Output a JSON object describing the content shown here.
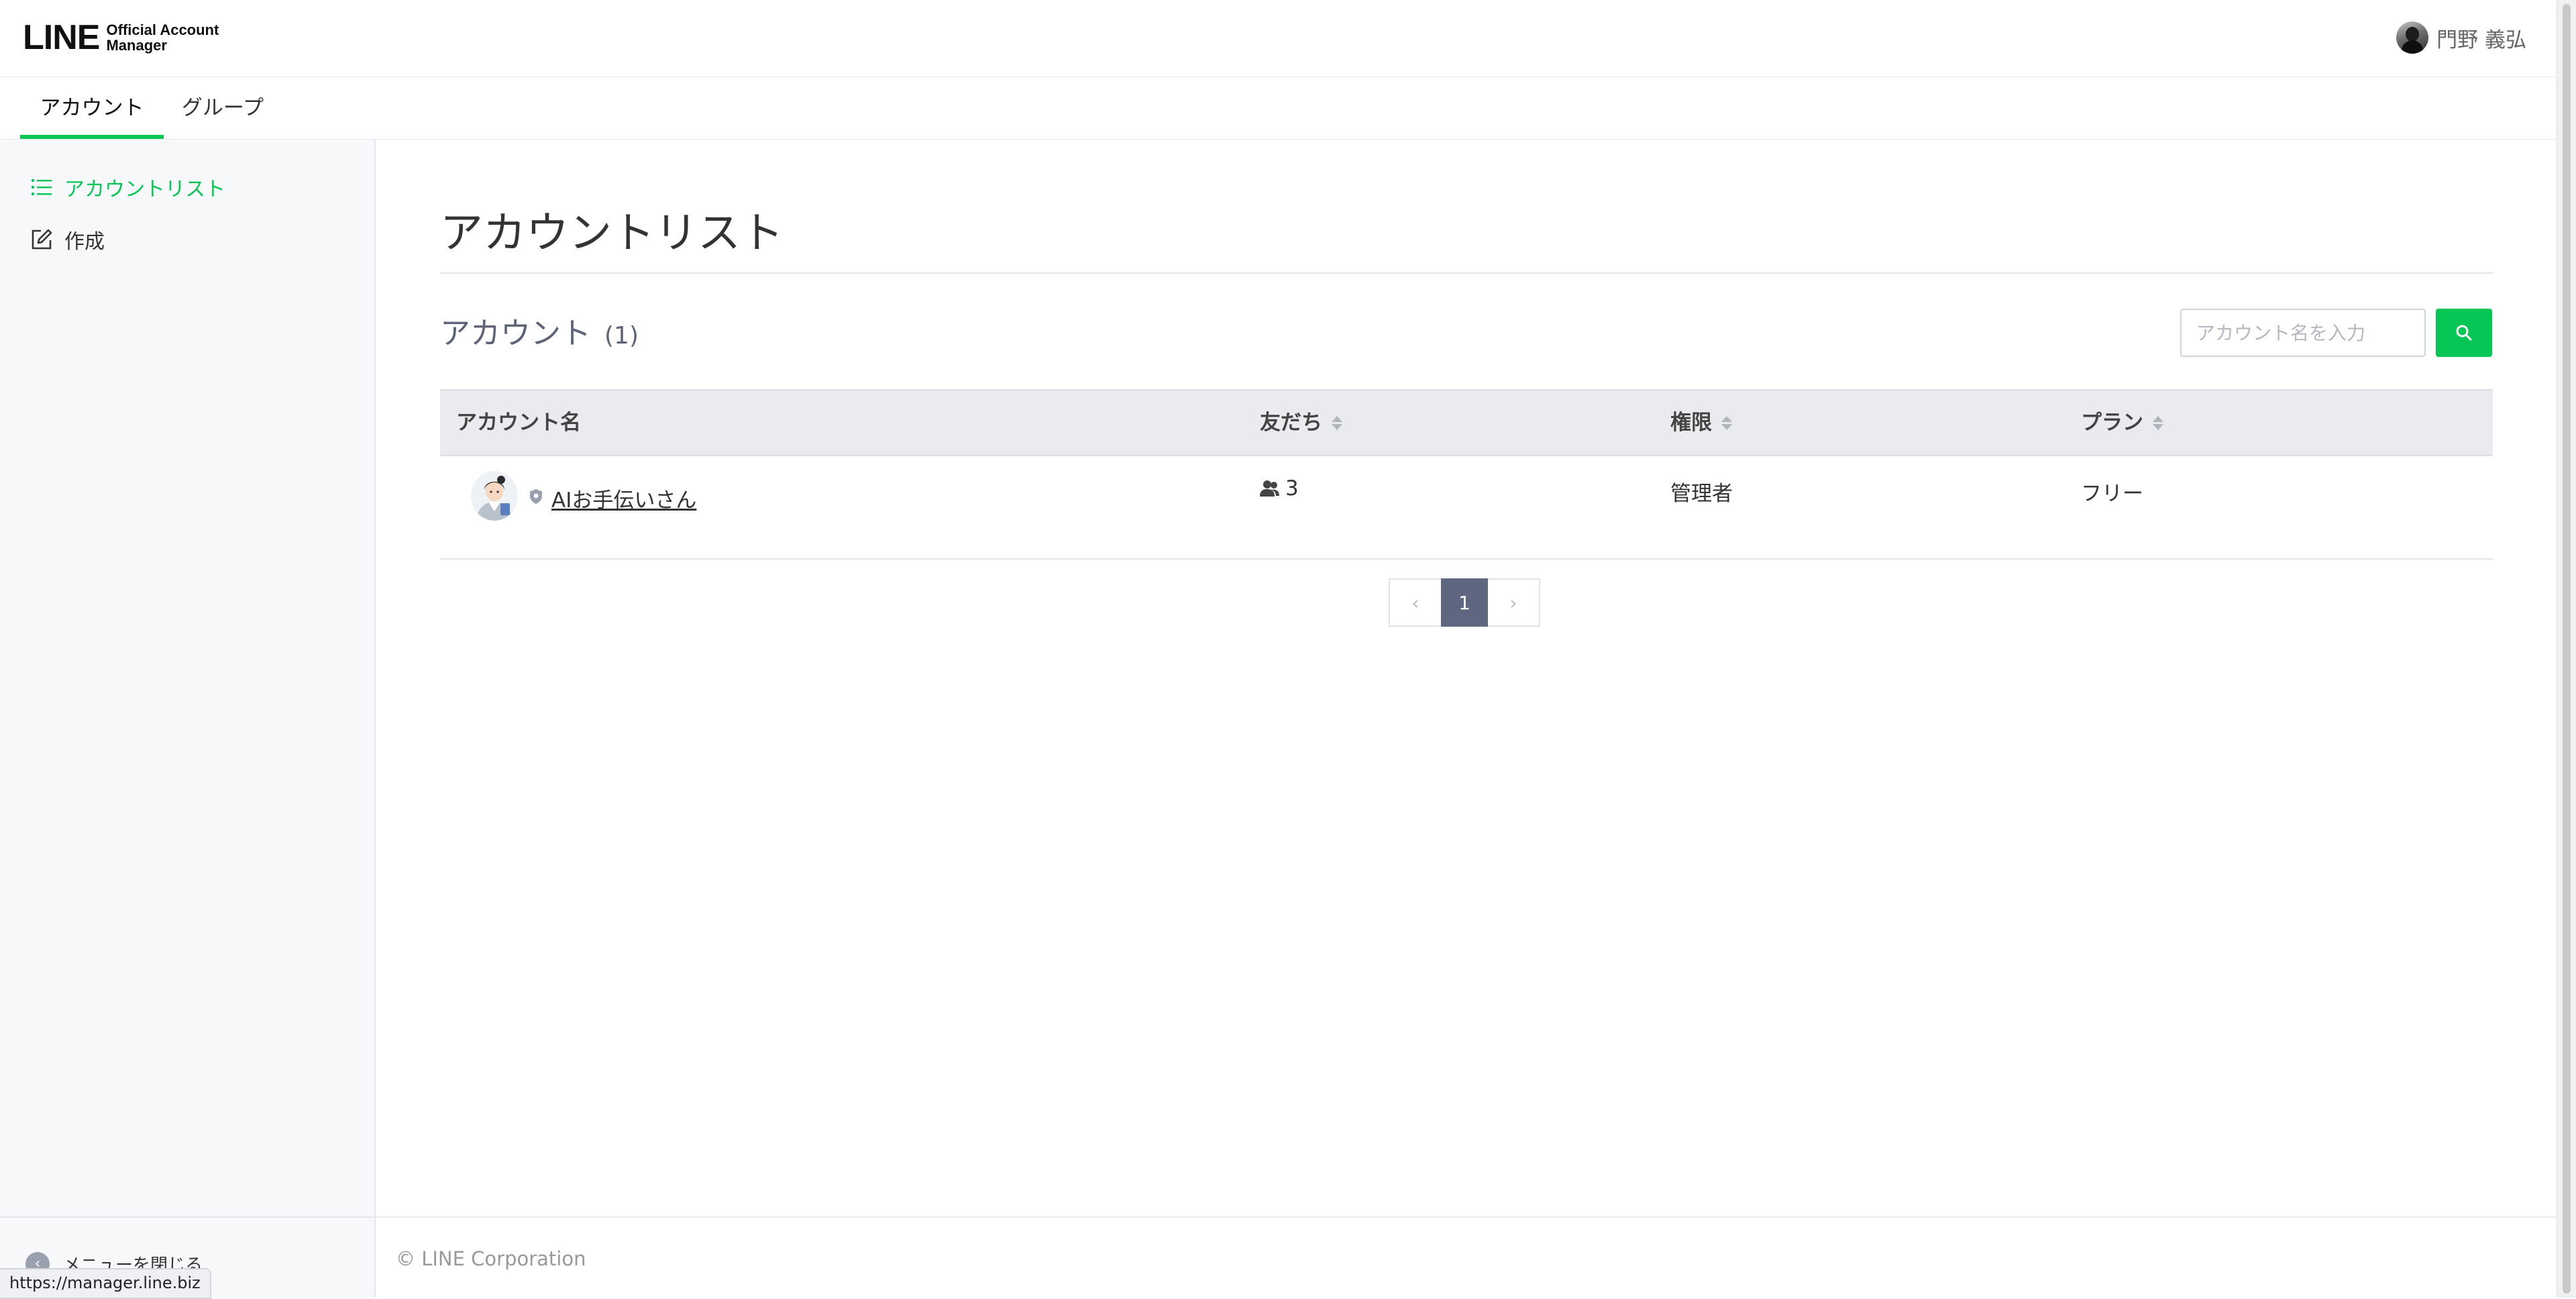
{
  "header": {
    "logo_main": "LINE",
    "logo_sub_line1": "Official Account",
    "logo_sub_line2": "Manager",
    "user_name": "門野 義弘"
  },
  "tabs": [
    {
      "label": "アカウント",
      "active": true
    },
    {
      "label": "グループ",
      "active": false
    }
  ],
  "sidebar": {
    "items": [
      {
        "label": "アカウントリスト",
        "icon": "list-icon",
        "active": true
      },
      {
        "label": "作成",
        "icon": "edit-icon",
        "active": false
      }
    ],
    "collapse_label": "メニューを閉じる"
  },
  "main": {
    "page_title": "アカウントリスト",
    "section_title": "アカウント",
    "count": "(1)",
    "search_placeholder": "アカウント名を入力",
    "table": {
      "headers": [
        "アカウント名",
        "友だち",
        "権限",
        "プラン"
      ],
      "rows": [
        {
          "name": "AIお手伝いさん",
          "friends": "3",
          "role": "管理者",
          "plan": "フリー"
        }
      ]
    },
    "pagination": {
      "current": "1"
    }
  },
  "footer": {
    "copyright": "© LINE Corporation"
  },
  "status_url": "https://manager.line.biz",
  "colors": {
    "accent": "#06c755",
    "pager_active": "#5f6780",
    "sidebar_bg": "#f7f8fa"
  }
}
